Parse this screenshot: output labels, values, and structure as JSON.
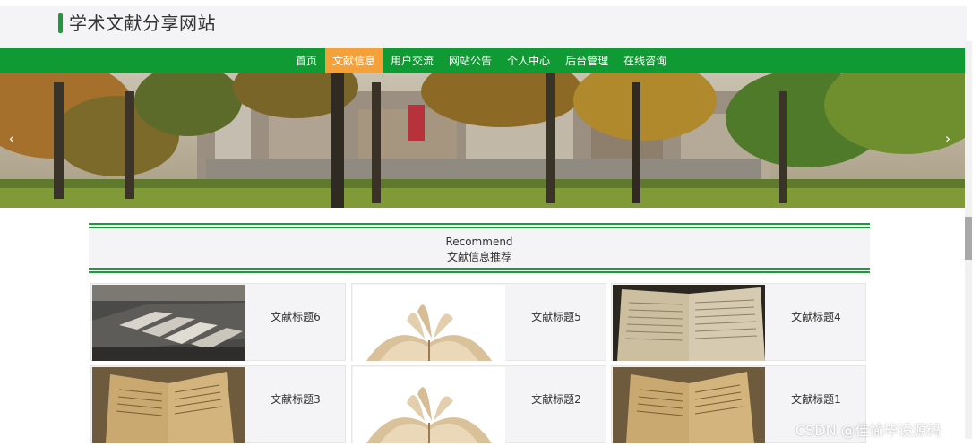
{
  "site": {
    "title": "学术文献分享网站"
  },
  "nav": {
    "items": [
      {
        "label": "首页"
      },
      {
        "label": "文献信息"
      },
      {
        "label": "用户交流"
      },
      {
        "label": "网站公告"
      },
      {
        "label": "个人中心"
      },
      {
        "label": "后台管理"
      },
      {
        "label": "在线咨询"
      }
    ],
    "active_index": 1
  },
  "banner": {
    "prev_icon": "‹",
    "next_icon": "›"
  },
  "section": {
    "title_en": "Recommend",
    "title_zh": "文献信息推荐"
  },
  "cards": [
    {
      "title": "文献标题6",
      "image": "library-bookshelf"
    },
    {
      "title": "文献标题5",
      "image": "open-book"
    },
    {
      "title": "文献标题4",
      "image": "book-pages"
    },
    {
      "title": "文献标题3",
      "image": "old-book"
    },
    {
      "title": "文献标题2",
      "image": "open-book"
    },
    {
      "title": "文献标题1",
      "image": "old-book"
    }
  ],
  "watermark": "CSDN @佳愉毕设源码",
  "colors": {
    "nav": "#0f9a33",
    "nav_active": "#f4a13a",
    "accent": "#1e9a3c"
  }
}
